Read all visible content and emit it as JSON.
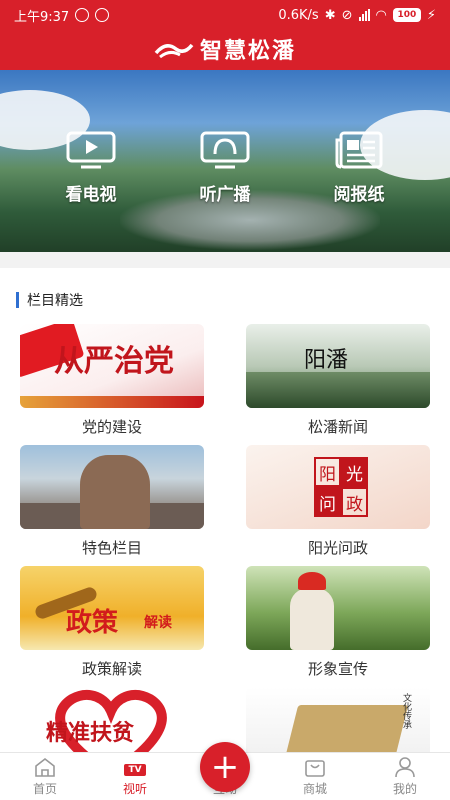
{
  "status_bar": {
    "time": "上午9:37",
    "network_speed": "0.6K/s",
    "battery": "100"
  },
  "header": {
    "title": "智慧松潘"
  },
  "hero": {
    "actions": [
      {
        "label": "看电视",
        "icon": "tv-icon"
      },
      {
        "label": "听广播",
        "icon": "radio-icon"
      },
      {
        "label": "阅报纸",
        "icon": "newspaper-icon"
      }
    ]
  },
  "section": {
    "title": "栏目精选"
  },
  "cards": [
    {
      "caption": "党的建设",
      "thumb_text": "从严治党"
    },
    {
      "caption": "松潘新闻",
      "thumb_text": "阳潘"
    },
    {
      "caption": "特色栏目",
      "thumb_text": ""
    },
    {
      "caption": "阳光问政",
      "thumb_text": [
        "阳",
        "光",
        "问",
        "政"
      ]
    },
    {
      "caption": "政策解读",
      "thumb_text": "政策",
      "thumb_text_small": "解读"
    },
    {
      "caption": "形象宣传",
      "thumb_text": ""
    },
    {
      "caption": "",
      "thumb_text": "精准扶贫"
    },
    {
      "caption": "",
      "thumb_text": "文化传承"
    }
  ],
  "bottom_nav": {
    "items": [
      {
        "label": "首页",
        "icon": "home-icon"
      },
      {
        "label": "视听",
        "icon": "tv-badge-icon",
        "badge": "TV",
        "active": true
      },
      {
        "label": "互动",
        "icon": "plus-icon"
      },
      {
        "label": "商城",
        "icon": "shop-icon"
      },
      {
        "label": "我的",
        "icon": "user-icon"
      }
    ],
    "fab_symbol": "+"
  },
  "colors": {
    "brand_red": "#d8202a",
    "section_accent": "#2f6fd1"
  }
}
